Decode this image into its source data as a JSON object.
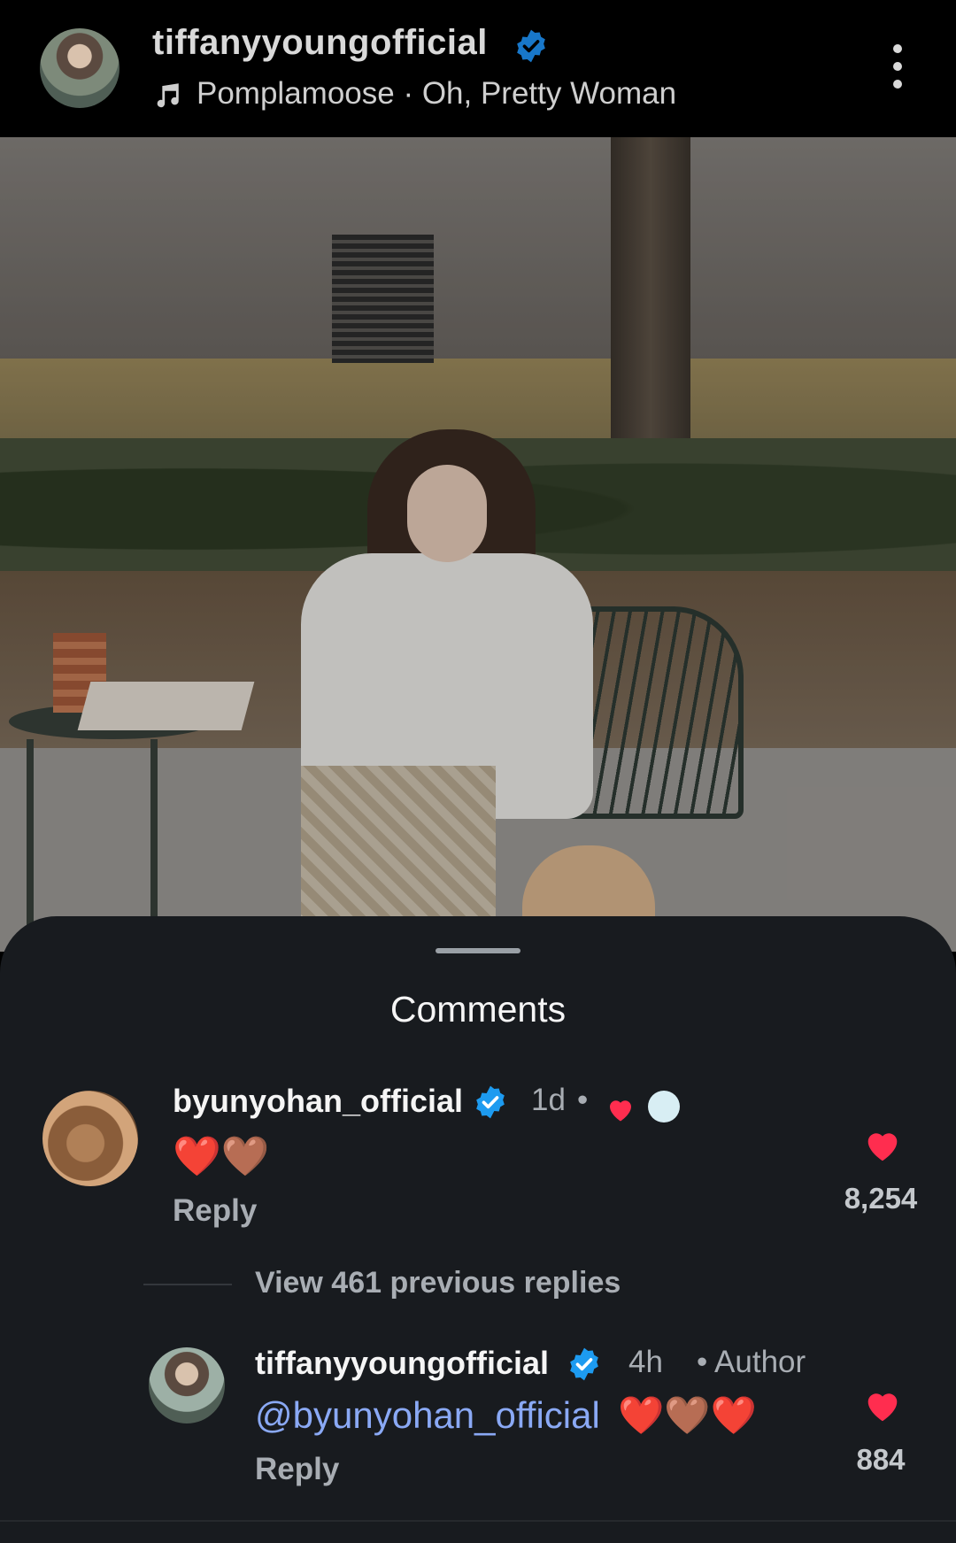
{
  "header": {
    "username": "tiffanyyoungofficial",
    "music_separator_text": "Pomplamoose · Oh, Pretty Woman"
  },
  "sheet": {
    "title": "Comments"
  },
  "comments": [
    {
      "username": "byunyohan_official",
      "time": "1d",
      "dot": "•",
      "text": "❤️🤎",
      "reply": "Reply",
      "likes": "8,254"
    }
  ],
  "view_replies": "View 461 previous replies",
  "reply": {
    "username": "tiffanyyoungofficial",
    "time": "4h",
    "author": "• Author",
    "mention": "@byunyohan_official",
    "emoji": "❤️🤎❤️",
    "reply": "Reply",
    "likes": "884"
  },
  "colors": {
    "sheet_bg": "#181b1f",
    "verified": "#1d9bf0",
    "like_red": "#ff2d4f",
    "mention": "#8aa9f5"
  },
  "icons": [
    "verified-badge-icon",
    "music-note-icon",
    "more-vertical-icon",
    "heart-icon"
  ]
}
